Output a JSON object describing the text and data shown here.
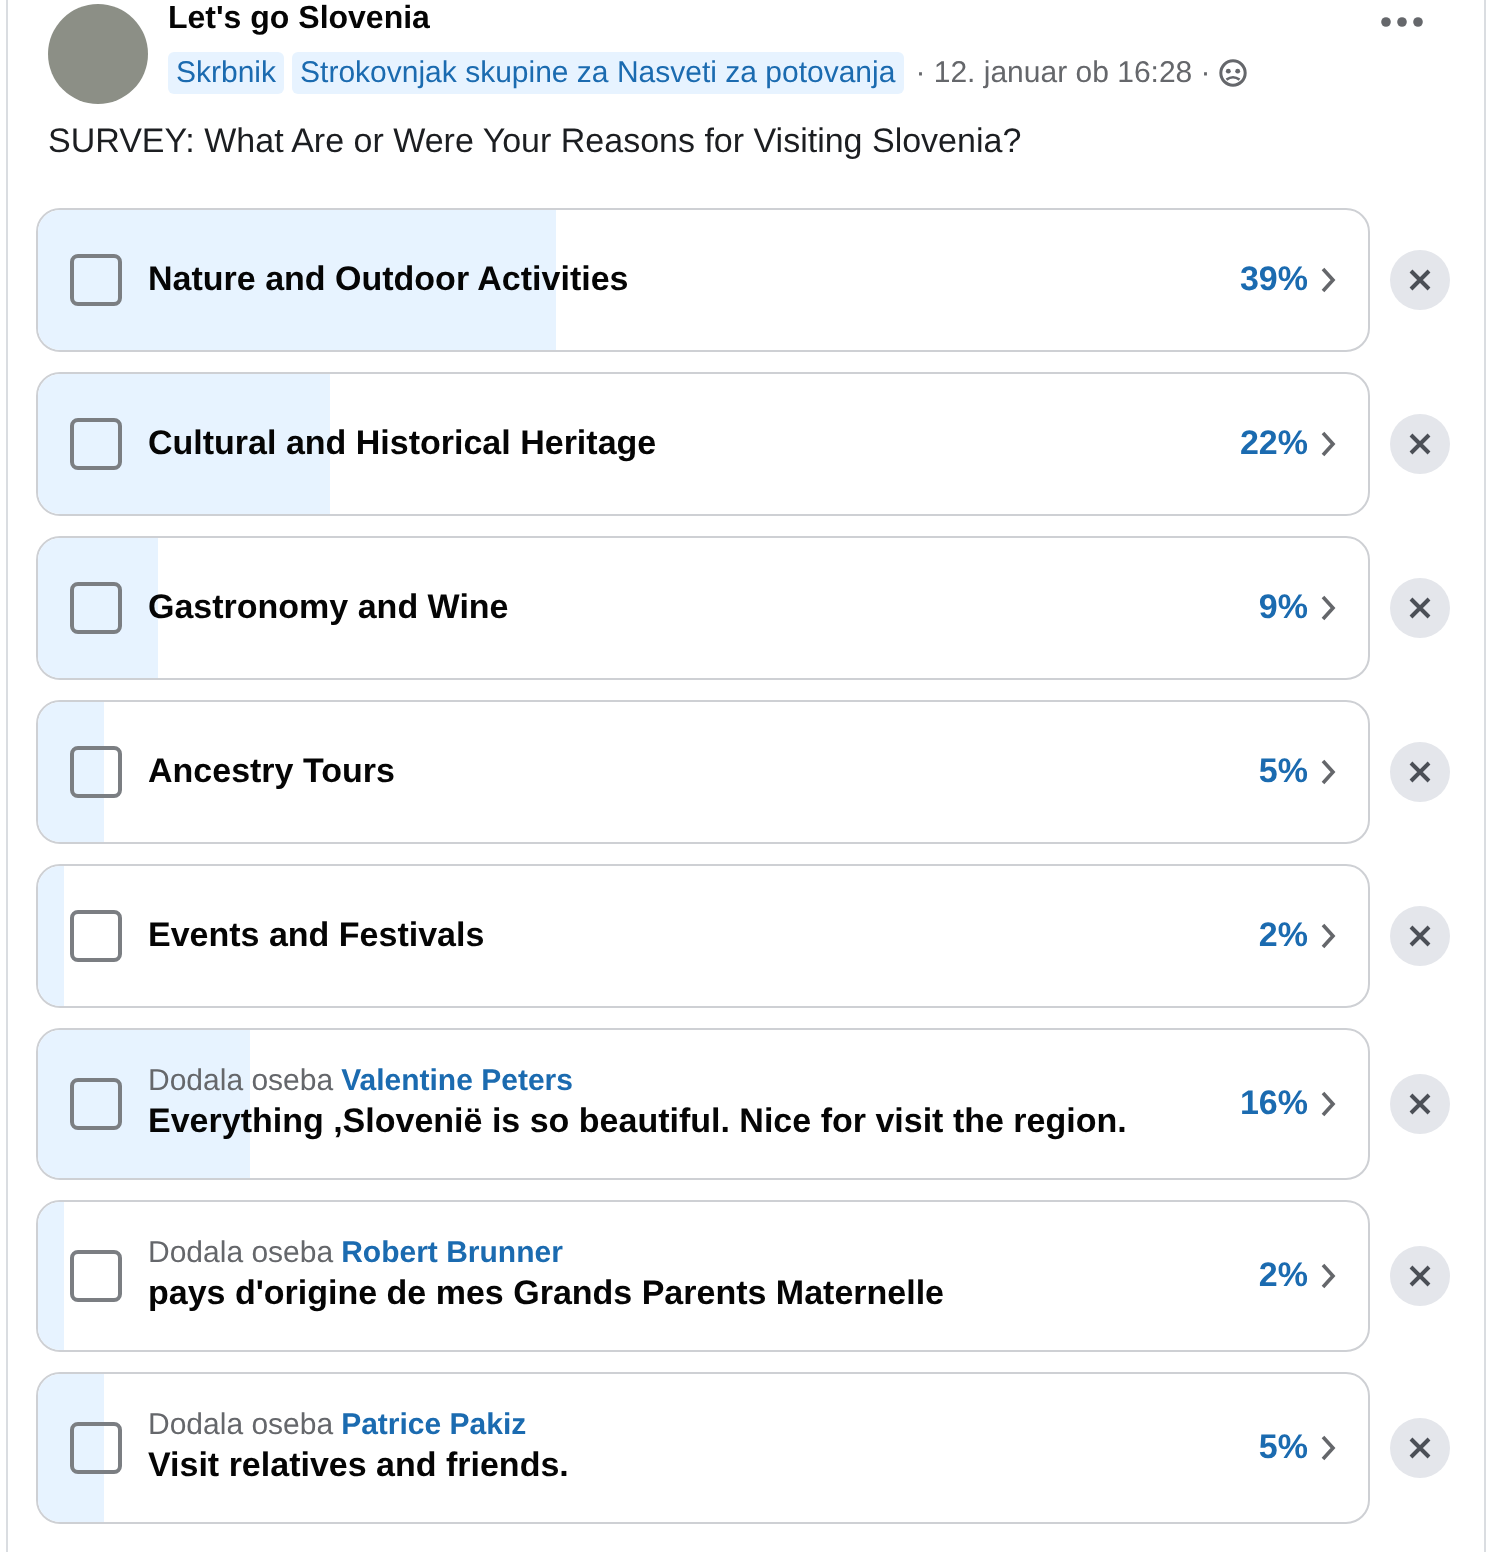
{
  "post": {
    "group_name": "Let's go Slovenia",
    "badges": [
      "Skrbnik",
      "Strokovnjak skupine za Nasveti za potovanja"
    ],
    "timestamp": "· 12. januar ob 16:28 ·",
    "question": "SURVEY: What Are or Were Your Reasons for Visiting Slovenia?"
  },
  "options": [
    {
      "kind": "plain",
      "label": "Nature and Outdoor Activities",
      "percent": "39%",
      "level": 0.39,
      "checked": false
    },
    {
      "kind": "plain",
      "label": "Cultural and Historical Heritage",
      "percent": "22%",
      "level": 0.22,
      "checked": false
    },
    {
      "kind": "plain",
      "label": "Gastronomy and Wine",
      "percent": "9%",
      "level": 0.09,
      "checked": false
    },
    {
      "kind": "plain",
      "label": "Ancestry Tours",
      "percent": "5%",
      "level": 0.05,
      "checked": false
    },
    {
      "kind": "plain",
      "label": "Events and Festivals",
      "percent": "2%",
      "level": 0.02,
      "checked": false
    },
    {
      "kind": "added",
      "added_by_label": "Dodala oseba",
      "added_by": "Valentine Peters",
      "label": "Everything ,Slovenië is so beautiful. Nice for visit the region.",
      "percent": "16%",
      "level": 0.16,
      "checked": false
    },
    {
      "kind": "added",
      "added_by_label": "Dodala oseba",
      "added_by": "Robert Brunner",
      "label": "pays d'origine de mes Grands Parents Maternelle",
      "percent": "2%",
      "level": 0.02,
      "checked": false
    },
    {
      "kind": "added",
      "added_by_label": "Dodala oseba",
      "added_by": "Patrice Pakiz",
      "label": "Visit relatives and friends.",
      "percent": "5%",
      "level": 0.05,
      "checked": false
    }
  ]
}
